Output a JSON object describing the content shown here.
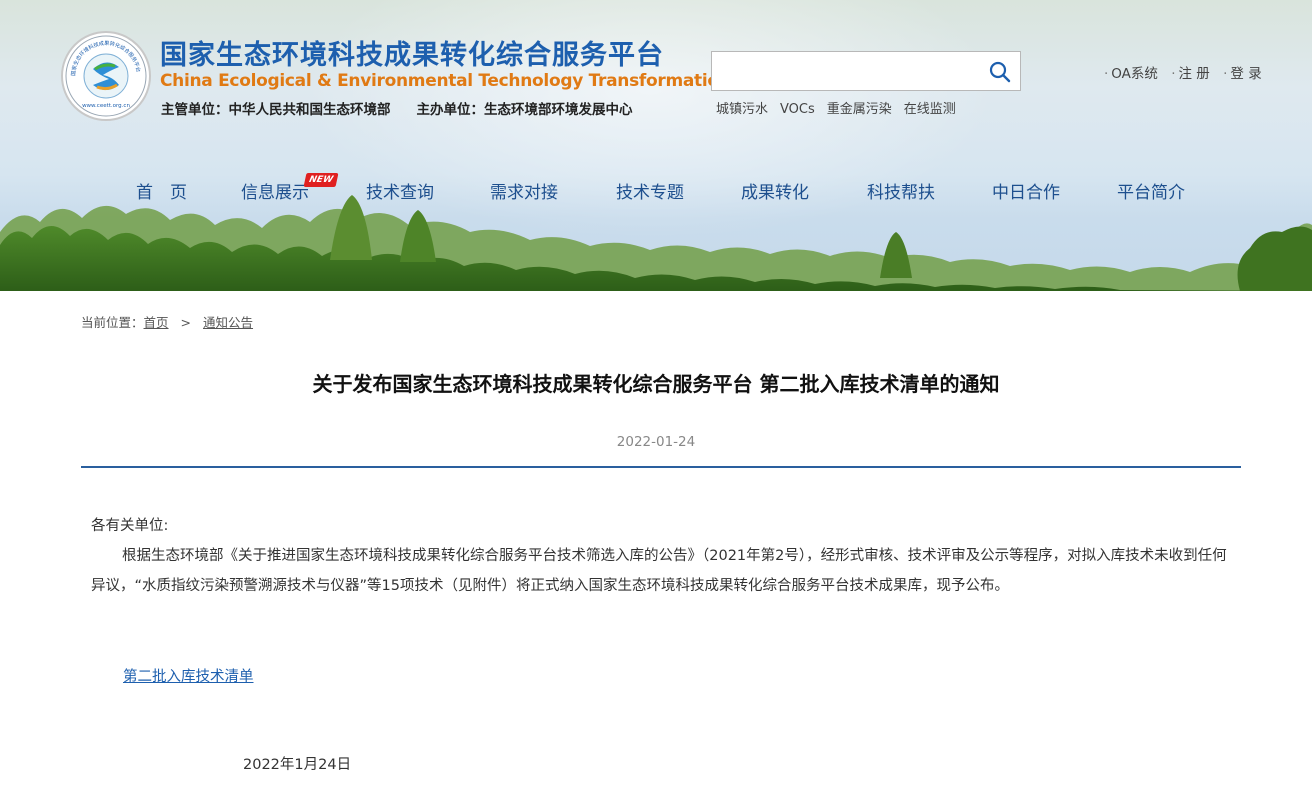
{
  "header": {
    "title_cn": "国家生态环境科技成果转化综合服务平台",
    "title_en": "China Ecological & Environmental Technology Transformation",
    "supervisor": "主管单位：中华人民共和国生态环境部",
    "organizer": "主办单位：生态环境部环境发展中心",
    "logo_ring_text": "国家生态环境科技成果转化综合服务平台",
    "logo_url_text": "www.ceett.org.cn"
  },
  "search": {
    "placeholder": "",
    "icon": "search-icon",
    "hot_words": [
      "城镇污水",
      "VOCs",
      "重金属污染",
      "在线监测"
    ]
  },
  "top_links": [
    "OA系统",
    "注 册",
    "登 录"
  ],
  "nav": {
    "items": [
      "首　页",
      "信息展示",
      "技术查询",
      "需求对接",
      "技术专题",
      "成果转化",
      "科技帮扶",
      "中日合作",
      "平台简介"
    ],
    "new_badge": "NEW"
  },
  "breadcrumb": {
    "label": "当前位置：",
    "items": [
      "首页",
      "通知公告"
    ],
    "separator": ">"
  },
  "article": {
    "title": "关于发布国家生态环境科技成果转化综合服务平台 第二批入库技术清单的通知",
    "date": "2022-01-24",
    "salutation": "各有关单位:",
    "paragraph": "根据生态环境部《关于推进国家生态环境科技成果转化综合服务平台技术筛选入库的公告》（2021年第2号），经形式审核、技术评审及公示等程序，对拟入库技术未收到任何异议，“水质指纹污染预警溯源技术与仪器”等15项技术（见附件）将正式纳入国家生态环境科技成果转化综合服务平台技术成果库，现予公布。",
    "attachment_link": "第二批入库技术清单",
    "sign_date": "2022年1月24日"
  },
  "colors": {
    "title_blue": "#1d5fae",
    "title_orange": "#e07a14",
    "nav_blue": "#1d4f8e",
    "divider": "#2a5f9e",
    "new_badge": "#e02020"
  }
}
